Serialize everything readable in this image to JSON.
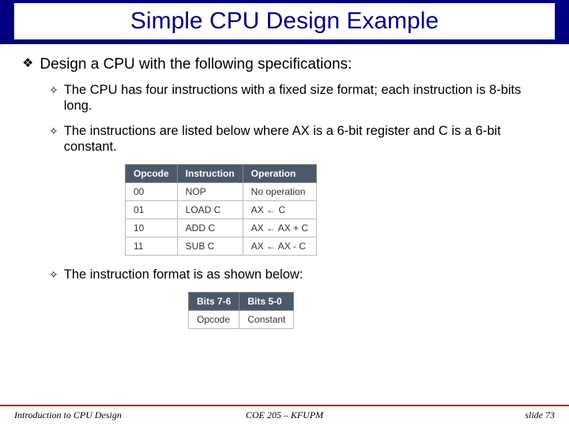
{
  "title": "Simple CPU Design Example",
  "bullets": {
    "main": "Design a CPU with the following specifications:",
    "sub1": "The CPU has four instructions with a fixed size format; each instruction is 8-bits long.",
    "sub2": "The instructions are listed below where AX is a 6-bit register and C is a 6-bit constant.",
    "sub3": "The instruction format is as shown below:"
  },
  "table1": {
    "headers": [
      "Opcode",
      "Instruction",
      "Operation"
    ],
    "rows": [
      [
        "00",
        "NOP",
        "No operation"
      ],
      [
        "01",
        "LOAD C",
        "AX ← C"
      ],
      [
        "10",
        "ADD C",
        "AX ← AX + C"
      ],
      [
        "11",
        "SUB C",
        "AX ← AX - C"
      ]
    ]
  },
  "table2": {
    "headers": [
      "Bits 7-6",
      "Bits 5-0"
    ],
    "rows": [
      [
        "Opcode",
        "Constant"
      ]
    ]
  },
  "footer": {
    "left": "Introduction to CPU Design",
    "mid": "COE 205 – KFUPM",
    "right": "slide 73"
  }
}
